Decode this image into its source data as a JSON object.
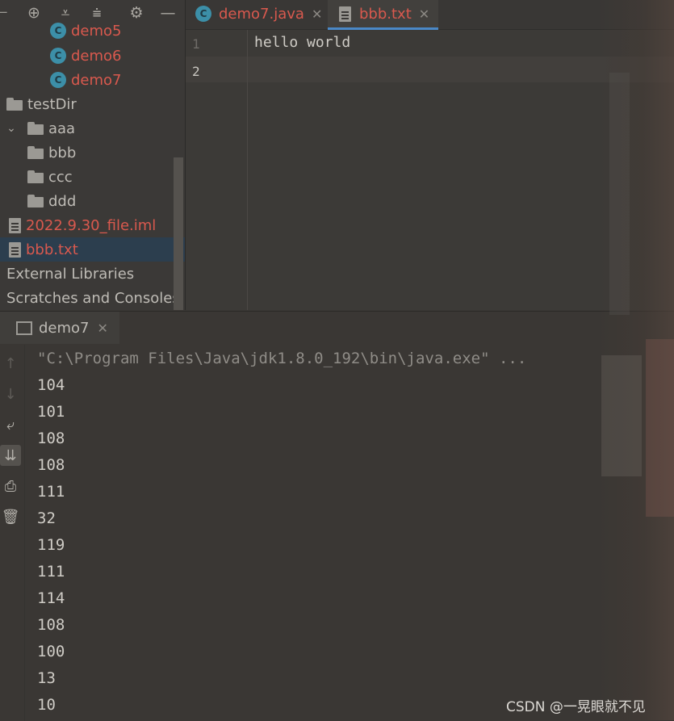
{
  "project": {
    "toolbar_icons": [
      "locate-icon",
      "expand-all-icon",
      "collapse-all-icon",
      "gear-icon",
      "minimize-icon"
    ],
    "items": [
      {
        "label": "demo5",
        "type": "class",
        "color": "red"
      },
      {
        "label": "demo6",
        "type": "class",
        "color": "red"
      },
      {
        "label": "demo7",
        "type": "class",
        "color": "red"
      },
      {
        "label": "testDir",
        "type": "folder",
        "color": "plain"
      },
      {
        "label": "aaa",
        "type": "folder",
        "color": "plain",
        "expanded": true
      },
      {
        "label": "bbb",
        "type": "folder",
        "color": "plain"
      },
      {
        "label": "ccc",
        "type": "folder",
        "color": "plain"
      },
      {
        "label": "ddd",
        "type": "folder",
        "color": "plain"
      },
      {
        "label": "2022.9.30_file.iml",
        "type": "iml",
        "color": "red"
      },
      {
        "label": "bbb.txt",
        "type": "text",
        "color": "red",
        "selected": true
      },
      {
        "label": "External Libraries",
        "type": "library",
        "color": "plain"
      },
      {
        "label": "Scratches and Consoles",
        "type": "scratch",
        "color": "plain"
      }
    ]
  },
  "editor": {
    "tabs": [
      {
        "label": "demo7.java",
        "icon": "java-class-icon",
        "active": false
      },
      {
        "label": "bbb.txt",
        "icon": "text-file-icon",
        "active": true
      }
    ],
    "lines": [
      {
        "number": "1",
        "text": "hello world"
      },
      {
        "number": "2",
        "text": ""
      }
    ]
  },
  "run": {
    "tab_label": "demo7",
    "command": "\"C:\\Program Files\\Java\\jdk1.8.0_192\\bin\\java.exe\" ...",
    "output": [
      "104",
      "101",
      "108",
      "108",
      "111",
      "32",
      "119",
      "111",
      "114",
      "108",
      "100",
      "13",
      "10"
    ],
    "side_icons": [
      "up-arrow-icon",
      "down-arrow-icon",
      "soft-wrap-icon",
      "scroll-to-end-icon",
      "print-icon",
      "trash-icon"
    ]
  },
  "watermark": "CSDN @一晃眼就不见",
  "colors": {
    "accent": "#4a88c7",
    "modified_file": "#d9594e",
    "selected_row": "#2c3e4e"
  }
}
